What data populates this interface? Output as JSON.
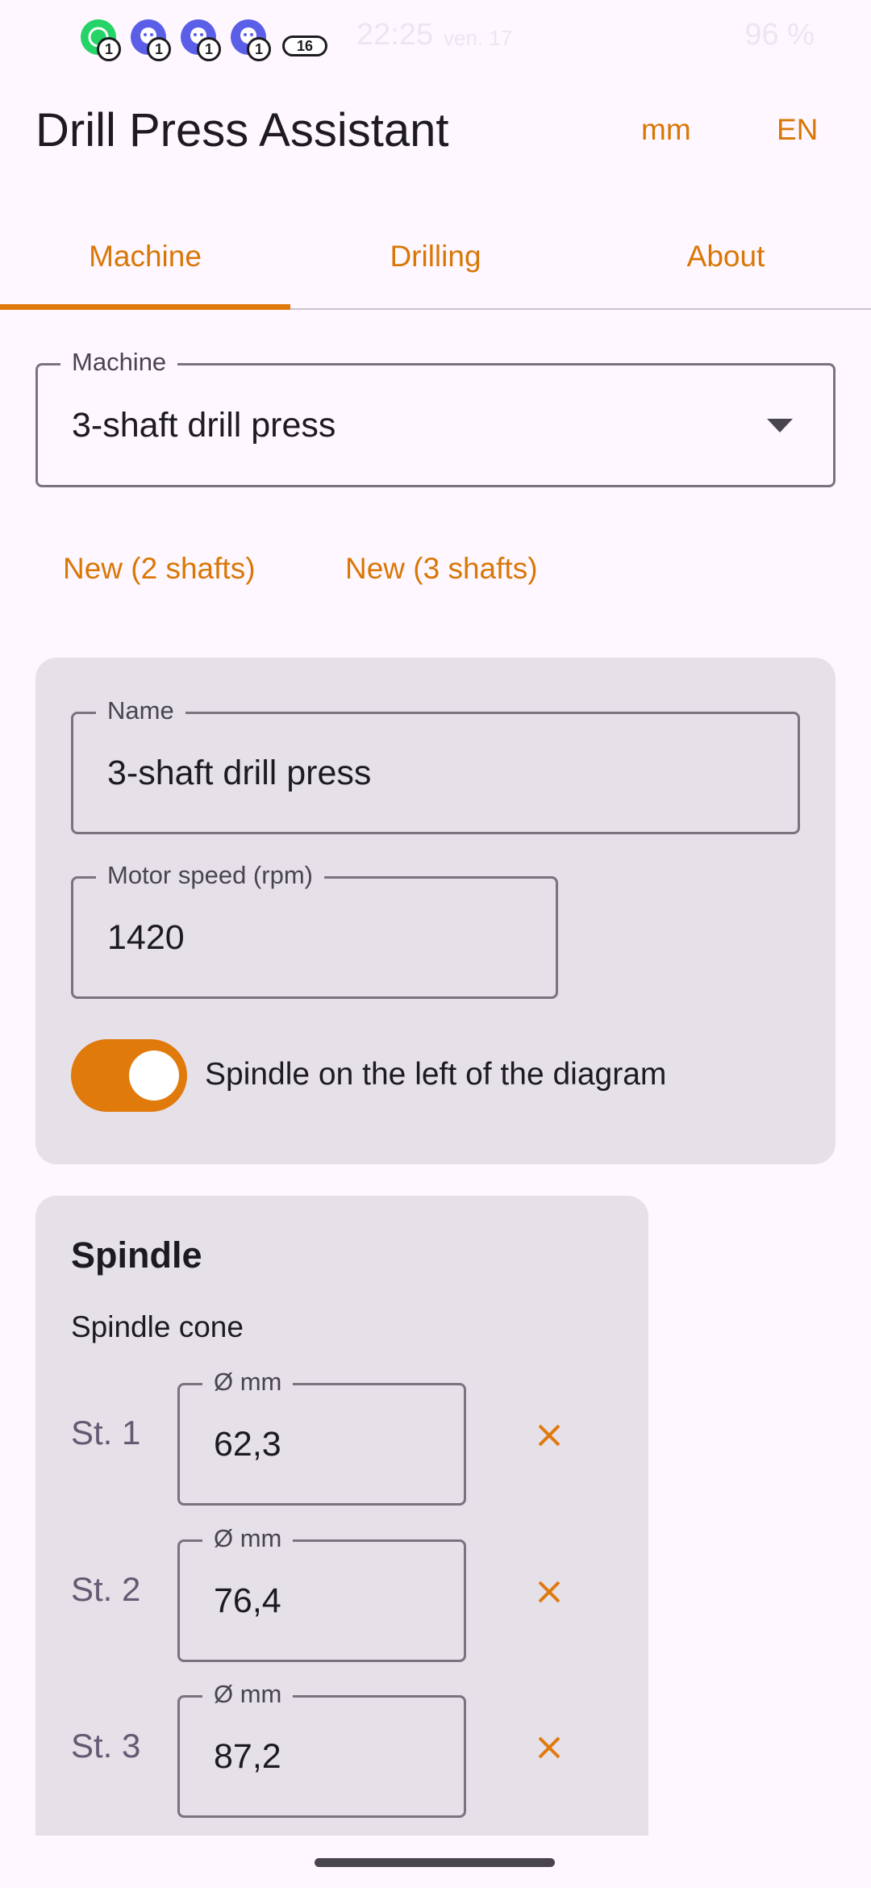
{
  "status": {
    "notifications": [
      {
        "icon": "whatsapp-icon",
        "count": "1"
      },
      {
        "icon": "messenger-icon",
        "count": "1"
      },
      {
        "icon": "messenger-icon",
        "count": "1"
      },
      {
        "icon": "messenger-icon",
        "count": "1"
      }
    ],
    "more_count": "16",
    "time": "22:25",
    "date": "ven. 17",
    "right": "96 %"
  },
  "app": {
    "title": "Drill Press Assistant",
    "unit_button": "mm",
    "lang_button": "EN"
  },
  "tabs": [
    {
      "label": "Machine",
      "selected": true
    },
    {
      "label": "Drilling",
      "selected": false
    },
    {
      "label": "About",
      "selected": false
    }
  ],
  "machine_select": {
    "label": "Machine",
    "value": "3-shaft drill press"
  },
  "actions": {
    "new_2": "New (2 shafts)",
    "new_3": "New (3 shafts)"
  },
  "settings": {
    "name_label": "Name",
    "name_value": "3-shaft drill press",
    "motor_label": "Motor speed (rpm)",
    "motor_value": "1420",
    "spindle_left_label": "Spindle on the left of the diagram",
    "spindle_left_on": true
  },
  "spindle": {
    "title": "Spindle",
    "cone_title": "Spindle cone",
    "steps": [
      {
        "label": "St. 1",
        "field_label": "Ø mm",
        "value": "62,3"
      },
      {
        "label": "St. 2",
        "field_label": "Ø mm",
        "value": "76,4"
      },
      {
        "label": "St. 3",
        "field_label": "Ø mm",
        "value": "87,2"
      }
    ]
  },
  "colors": {
    "accent": "#D97706",
    "background": "#FEF7FF",
    "card": "#E6E0E9"
  }
}
